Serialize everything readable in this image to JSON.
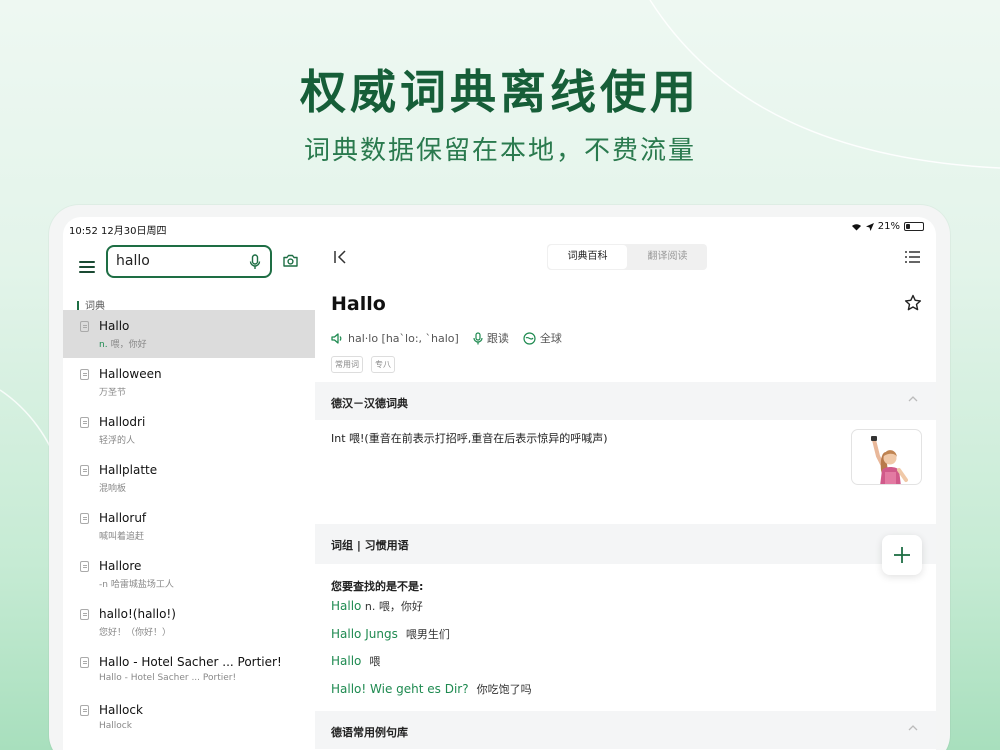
{
  "hero": {
    "title": "权威词典离线使用",
    "subtitle": "词典数据保留在本地，不费流量"
  },
  "status_bar": {
    "time": "10:52  12月30日周四",
    "battery": "21%"
  },
  "search": {
    "value": "hallo"
  },
  "sidebar": {
    "section_label": "词典",
    "items": [
      {
        "title": "Hallo",
        "pos": "n.",
        "sub": "喂，你好",
        "selected": true
      },
      {
        "title": "Halloween",
        "pos": "",
        "sub": "万圣节",
        "selected": false
      },
      {
        "title": "Hallodri",
        "pos": "",
        "sub": "轻浮的人",
        "selected": false
      },
      {
        "title": "Hallplatte",
        "pos": "",
        "sub": "混响板",
        "selected": false
      },
      {
        "title": "Halloruf",
        "pos": "",
        "sub": "喊叫着追赶",
        "selected": false
      },
      {
        "title": "Hallore",
        "pos": "",
        "sub": "-n  哈雷城盐场工人",
        "selected": false
      },
      {
        "title": "hallo!(hallo!)",
        "pos": "",
        "sub": "您好！（你好！）",
        "selected": false
      },
      {
        "title": "Hallo - Hotel Sacher ... Portier!",
        "pos": "",
        "sub": "Hallo - Hotel Sacher ... Portier!",
        "selected": false
      },
      {
        "title": "Hallock",
        "pos": "",
        "sub": "Hallock",
        "selected": false
      }
    ]
  },
  "tabs": [
    {
      "label": "词典百科",
      "active": true
    },
    {
      "label": "翻译阅读",
      "active": false
    }
  ],
  "entry": {
    "word": "Hallo",
    "phonetic": "hal·lo [ha`lo:, `halo]",
    "follow_read": "跟读",
    "global": "全球",
    "tags": [
      "常用词",
      "专八"
    ]
  },
  "sections": {
    "dict_title": "德汉－汉德词典",
    "definition": "Int 喂!(重音在前表示打招呼,重音在后表示惊异的呼喊声)",
    "phrases_title": "词组 | 习惯用语",
    "ask": "您要查找的是不是:",
    "examples_title": "德语常用例句库"
  },
  "suggestions": [
    {
      "de": "Hallo",
      "cn": " n. 喂，你好"
    },
    {
      "de": "Hallo Jungs",
      "cn": "喂男生们"
    },
    {
      "de": "Hallo",
      "cn": "喂"
    },
    {
      "de": "Hallo! Wie geht es Dir?",
      "cn": "你吃饱了吗"
    }
  ],
  "colors": {
    "brand_green": "#1e6e44",
    "link_green": "#1e8a50"
  }
}
